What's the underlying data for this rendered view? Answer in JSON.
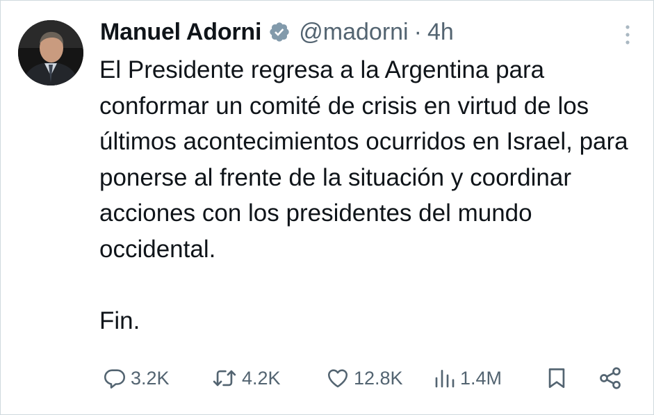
{
  "tweet": {
    "author": {
      "name": "Manuel Adorni",
      "handle": "@madorni",
      "verified": true
    },
    "separator": "·",
    "time": "4h",
    "text": "El Presidente regresa a la Argentina para conformar un comité de crisis en virtud de los últimos acontecimientos ocurridos en Israel, para ponerse al frente de la situación y coordinar acciones con los presidentes del mundo occidental.\n\nFin.",
    "actions": {
      "reply": {
        "icon": "reply-icon",
        "count": "3.2K"
      },
      "retweet": {
        "icon": "retweet-icon",
        "count": "4.2K"
      },
      "like": {
        "icon": "heart-icon",
        "count": "12.8K"
      },
      "views": {
        "icon": "views-icon",
        "count": "1.4M"
      },
      "bookmark": {
        "icon": "bookmark-icon"
      },
      "share": {
        "icon": "share-icon"
      }
    }
  },
  "colors": {
    "text": "#0f1419",
    "muted": "#536471",
    "verified": "#829aab",
    "border": "#cfd9de"
  }
}
